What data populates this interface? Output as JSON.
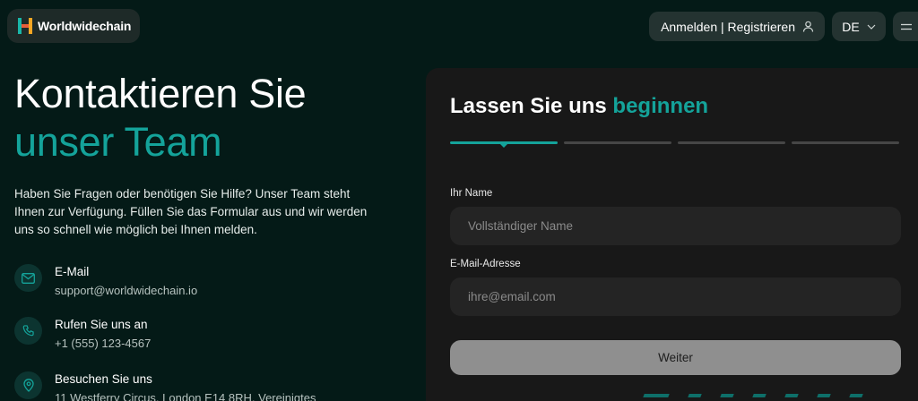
{
  "header": {
    "brand": "Worldwidechain",
    "login_label": "Anmelden | Registrieren",
    "language": "DE",
    "icons": {
      "login": "user-icon",
      "language": "chevron-down-icon",
      "menu": "hamburger-menu-icon"
    }
  },
  "hero": {
    "title_line1": "Kontaktieren Sie",
    "title_line2": "unser Team",
    "description": "Haben Sie Fragen oder benötigen Sie Hilfe? Unser Team steht Ihnen zur Verfügung. Füllen Sie das Formular aus und wir werden uns so schnell wie möglich bei Ihnen melden."
  },
  "contacts": [
    {
      "label": "E-Mail",
      "value": "support@worldwidechain.io",
      "icon": "mail-icon"
    },
    {
      "label": "Rufen Sie uns an",
      "value": "+1 (555) 123-4567",
      "icon": "phone-icon"
    },
    {
      "label": "Besuchen Sie uns",
      "value": "11 Westferry Circus, London E14 8RH, Vereinigtes",
      "icon": "map-pin-icon"
    }
  ],
  "form": {
    "title_prefix": "Lassen Sie uns",
    "title_accent": "beginnen",
    "steps_total": 4,
    "current_step": 1,
    "name_label": "Ihr Name",
    "name_placeholder": "Vollständiger Name",
    "name_value": "",
    "email_label": "E-Mail-Adresse",
    "email_placeholder": "ihre@email.com",
    "email_value": "",
    "next_label": "Weiter"
  },
  "colors": {
    "background": "#041a17",
    "accent": "#14a39a",
    "card": "#181818",
    "input": "#242424",
    "button_disabled": "#8f8f8f"
  }
}
